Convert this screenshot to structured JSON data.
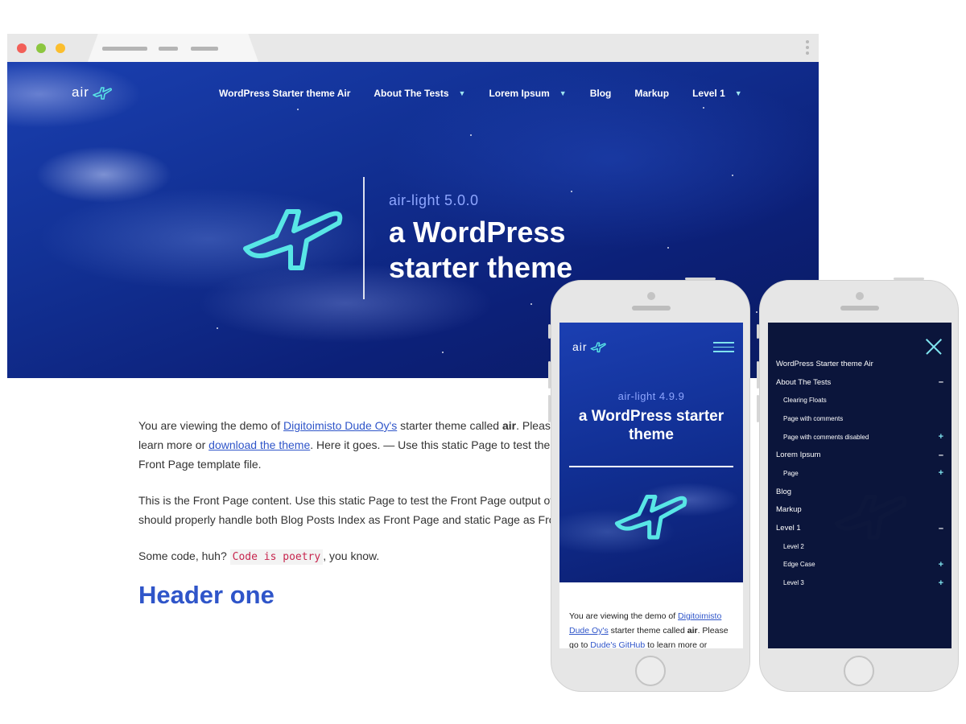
{
  "browser": {
    "traffic_lights": {
      "close": "#f25f58",
      "minimize": "#8cc63f",
      "maximize": "#fbbe2e"
    }
  },
  "site": {
    "logo_text": "air",
    "nav": [
      {
        "label": "WordPress Starter theme Air",
        "has_dropdown": false
      },
      {
        "label": "About The Tests",
        "has_dropdown": true
      },
      {
        "label": "Lorem Ipsum",
        "has_dropdown": true
      },
      {
        "label": "Blog",
        "has_dropdown": false
      },
      {
        "label": "Markup",
        "has_dropdown": false
      },
      {
        "label": "Level 1",
        "has_dropdown": true
      }
    ],
    "hero": {
      "version": "air-light 5.0.0",
      "title": "a WordPress starter theme"
    },
    "content": {
      "p1_a": "You are viewing the demo of ",
      "p1_link1": "Digitoimisto Dude Oy's",
      "p1_b": " starter theme called ",
      "p1_bold": "air",
      "p1_c": ". Please",
      "p1_d": "learn more or ",
      "p1_link2": "download the theme",
      "p1_e": ". Here it goes. — Use this static Page to test the",
      "p1_f": "Front Page template file.",
      "p2_a": "This is the Front Page content. Use this static Page to test the Front Page output of",
      "p2_b": "should properly handle both Blog Posts Index as Front Page and static Page as Fro",
      "p3_a": "Some code, huh? ",
      "p3_code": "Code is poetry",
      "p3_b": ", you know.",
      "heading": "Header one"
    },
    "colors": {
      "accent": "#2f55c9",
      "plane": "#58e6e6",
      "hero_dark": "#0c2078"
    }
  },
  "phone1": {
    "logo_text": "air",
    "version": "air-light 4.9.9",
    "title": "a WordPress starter theme",
    "text_a": "You are viewing the demo of ",
    "link1": "Digitoimisto Dude Oy's",
    "text_b": " starter theme called ",
    "bold": "air",
    "text_c": ". Please go to ",
    "link2": "Dude's GitHub",
    "text_d": " to learn more or"
  },
  "phone2": {
    "menu": [
      {
        "label": "WordPress Starter theme Air",
        "sub": false,
        "sign": ""
      },
      {
        "label": "About The Tests",
        "sub": false,
        "sign": "–"
      },
      {
        "label": "Clearing Floats",
        "sub": true,
        "sign": ""
      },
      {
        "label": "Page with comments",
        "sub": true,
        "sign": ""
      },
      {
        "label": "Page with comments disabled",
        "sub": true,
        "sign": "+"
      },
      {
        "label": "Lorem Ipsum",
        "sub": false,
        "sign": "–"
      },
      {
        "label": "Page",
        "sub": true,
        "sign": "+"
      },
      {
        "label": "Blog",
        "sub": false,
        "sign": ""
      },
      {
        "label": "Markup",
        "sub": false,
        "sign": ""
      },
      {
        "label": "Level 1",
        "sub": false,
        "sign": "–"
      },
      {
        "label": "Level 2",
        "sub": true,
        "sign": ""
      },
      {
        "label": "Edge Case",
        "sub": true,
        "sign": "+"
      },
      {
        "label": "Level 3",
        "sub": true,
        "sign": "+"
      }
    ]
  }
}
